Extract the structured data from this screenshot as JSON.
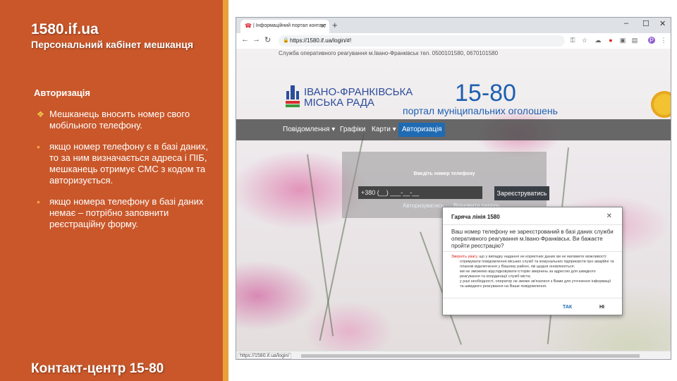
{
  "slide": {
    "title": "1580.if.ua",
    "subtitle": "Персональний  кабінет мешканця",
    "section": "Авторизація",
    "bullets": [
      "Мешканець вносить номер свого мобільного телефону.",
      "якщо номер телефону є в базі даних, то за ним визначається адреса і ПІБ, мешканець отримує СМС з кодом та авторизується.",
      "якщо номера телефону в базі даних немає – потрібно заповнити реєстраційну форму."
    ],
    "contact": "Контакт-центр 15-80",
    "colors": {
      "panel": "#c9572a",
      "stripe": "#e9a23a",
      "bullet": "#f2c94c"
    }
  },
  "browser": {
    "tab_title": "| Інформаційний портал контакт",
    "url": "https://1580.if.ua/login/#!",
    "status_url": "https://1580.if.ua/login/"
  },
  "site": {
    "service_line": "Служба оперативного реагування м.Івано-Франківськ тел. 0500101580, 0670101580",
    "logo_line1": "ІВАНО-ФРАНКІВСЬКА",
    "logo_line2": "МІСЬКА РАДА",
    "logo_number": "15-80",
    "portal_tagline": "портал муніципальних оголошень",
    "nav": [
      "Повідомлення ▾",
      "Графіки",
      "Карти ▾",
      "Авторизація"
    ],
    "accent": "#1f6bb3"
  },
  "login": {
    "label": "Введіть номер телефону",
    "phone_value": "+380 (__) ___-__-__",
    "register_button": "Зареєструватись",
    "authorize_link": "Авторизуватись",
    "restore_link": "Відновити пароль"
  },
  "modal": {
    "title": "Гаряча лінія 1580",
    "question": "Ваш номер телефону не зареєстрований в базі даних служби оперативного реагування м.Івано-Франківськ. Ви бажаєте пройти реєстрацію?",
    "warning_label": "Зверніть увагу,",
    "warning_text": " що у випадку надання не коректних даних ви не матимете можливості:",
    "notes": [
      "отримувати повідомлення міських служб та комунальних підприємств про аварійні та планові відключення у Вашому районі, які щодня оновлюються;",
      "ми не зможемо відслідковувати історію звернень за адресою для швидкого реагування та координації служб міста;",
      "у разі необхідності, оператор не зможе зв'язатися з Вами для уточнення інформації та швидкого реагування на Ваше повідомлення."
    ],
    "yes_button": "ТАК",
    "no_button": "НІ",
    "yes_color": "#1f6bb3"
  }
}
